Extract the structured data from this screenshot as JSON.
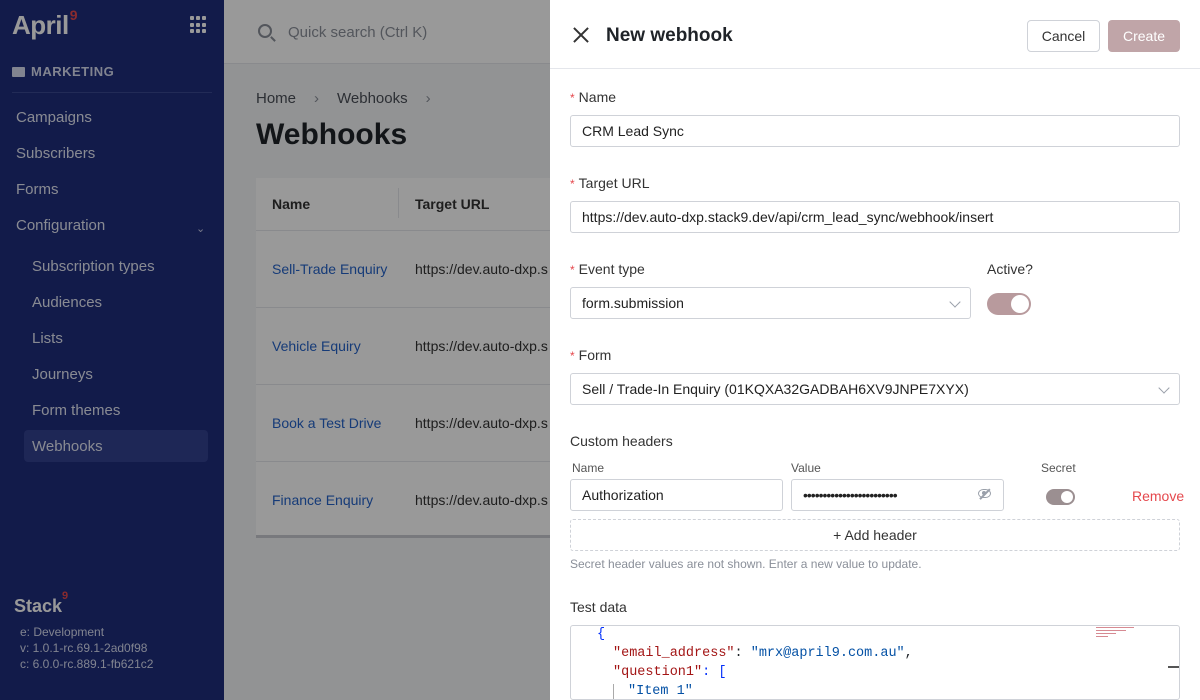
{
  "sidebar": {
    "logo_text": "April",
    "logo_mark": "9",
    "section": "MARKETING",
    "items": [
      "Campaigns",
      "Subscribers",
      "Forms",
      "Configuration"
    ],
    "sub_items": [
      "Subscription types",
      "Audiences",
      "Lists",
      "Journeys",
      "Form themes",
      "Webhooks"
    ],
    "active_item": "Webhooks",
    "footer": {
      "brand": "Stack",
      "brand_mark": "9",
      "env": "e: Development",
      "version": "v: 1.0.1-rc.69.1-2ad0f98",
      "core": "c: 6.0.0-rc.889.1-fb621c2"
    }
  },
  "header": {
    "search_placeholder": "Quick search (Ctrl K)"
  },
  "main": {
    "breadcrumb": [
      "Home",
      "Webhooks"
    ],
    "title": "Webhooks",
    "columns": [
      "Name",
      "Target URL"
    ],
    "rows": [
      {
        "name": "Sell-Trade Enquiry",
        "url": "https://dev.auto-dxp.s"
      },
      {
        "name": "Vehicle Equiry",
        "url": "https://dev.auto-dxp.s"
      },
      {
        "name": "Book a Test Drive",
        "url": "https://dev.auto-dxp.s"
      },
      {
        "name": "Finance Enquiry",
        "url": "https://dev.auto-dxp.s"
      }
    ]
  },
  "drawer": {
    "title": "New webhook",
    "cancel_label": "Cancel",
    "create_label": "Create",
    "required_mark": "*",
    "name_label": "Name",
    "name_value": "CRM Lead Sync",
    "target_label": "Target URL",
    "target_value": "https://dev.auto-dxp.stack9.dev/api/crm_lead_sync/webhook/insert",
    "event_label": "Event type",
    "event_value": "form.submission",
    "active_label": "Active?",
    "active_on": true,
    "form_label": "Form",
    "form_value": "Sell / Trade-In Enquiry (01KQXA32GADBAH6XV9JNPE7XYX)",
    "custom_headers_label": "Custom headers",
    "header_cols": {
      "name": "Name",
      "value": "Value",
      "secret": "Secret"
    },
    "header_row": {
      "name": "Authorization",
      "value": "••••••••••••••••••••••••",
      "secret_on": true
    },
    "remove_label": "Remove",
    "add_header_label": "+ Add header",
    "hint": "Secret header values are not shown. Enter a new value to update.",
    "test_data_label": "Test data",
    "code_lines": {
      "l1": "{",
      "k2": "\"email_address\"",
      "p2": ": ",
      "v2": "\"mrx@april9.com.au\"",
      "c2": ",",
      "k3": "\"question1\"",
      "p3": ": [",
      "v4": "\"Item 1\""
    }
  },
  "colors": {
    "sidebar_bg": "#1e2d7c",
    "active_nav": "#33418f",
    "brand_accent": "#e5484d",
    "link": "#2563c9",
    "create_disabled": "#c0a5a8"
  }
}
